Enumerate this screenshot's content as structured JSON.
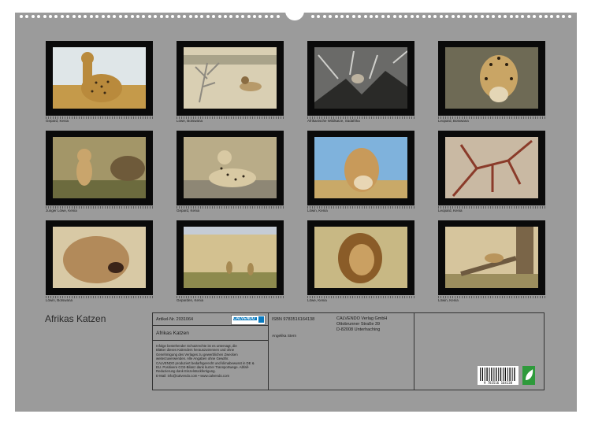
{
  "photos": [
    {
      "caption": "Gepard, Kenia"
    },
    {
      "caption": "Löwe, Botswana"
    },
    {
      "caption": "Afrikanische Wildkatze, Südafrika"
    },
    {
      "caption": "Leopard, Botswana"
    },
    {
      "caption": "Junger Löwe, Kenia"
    },
    {
      "caption": "Gepard, Kenia"
    },
    {
      "caption": "Löwin, Kenia"
    },
    {
      "caption": "Leopard, Kenia"
    },
    {
      "caption": "Löwin, Botswana"
    },
    {
      "caption": "Geparden, Kenia"
    },
    {
      "caption": "Löwe, Kenia"
    },
    {
      "caption": "Löwin, Kenia"
    }
  ],
  "calendar_title": "Afrikas Katzen",
  "info": {
    "article_no": "Artikel-Nr. 2031064",
    "product_title": "Afrikas Katzen",
    "isbn": "ISBN 9783516164138",
    "author": "Angelika Stern",
    "publisher_lines": [
      "CALVENDO Verlag GmbH",
      "Ottobrunner Straße 39",
      "D-82008 Unterhaching"
    ],
    "legal_lines": [
      "Infolge bestehender Schutzrechte ist es untersagt, die",
      "Blätter dieses Kalenders herauszutrennen und ohne",
      "Genehmigung des Verlages zu gewerblichen Zwecken",
      "weiterzuverwenden. Alle Angaben ohne Gewähr.",
      "CALVENDO produziert bedarfsgerecht und klimabewusst in DE &",
      "EU. Positivere CO2-Bilanz dank kurzer Transportwege. Abfall-",
      "Reduzierung dank Einzelstückfertigung.",
      "E-Mail: info@calvendo.com • www.calvendo.com"
    ],
    "barcode_digits": "9 783516 164138",
    "logo_text": "CALVENDO"
  },
  "colors": {
    "sheet": "#9b9b9b",
    "frame": "#0a0a0a",
    "accent": "#0a7abf"
  }
}
